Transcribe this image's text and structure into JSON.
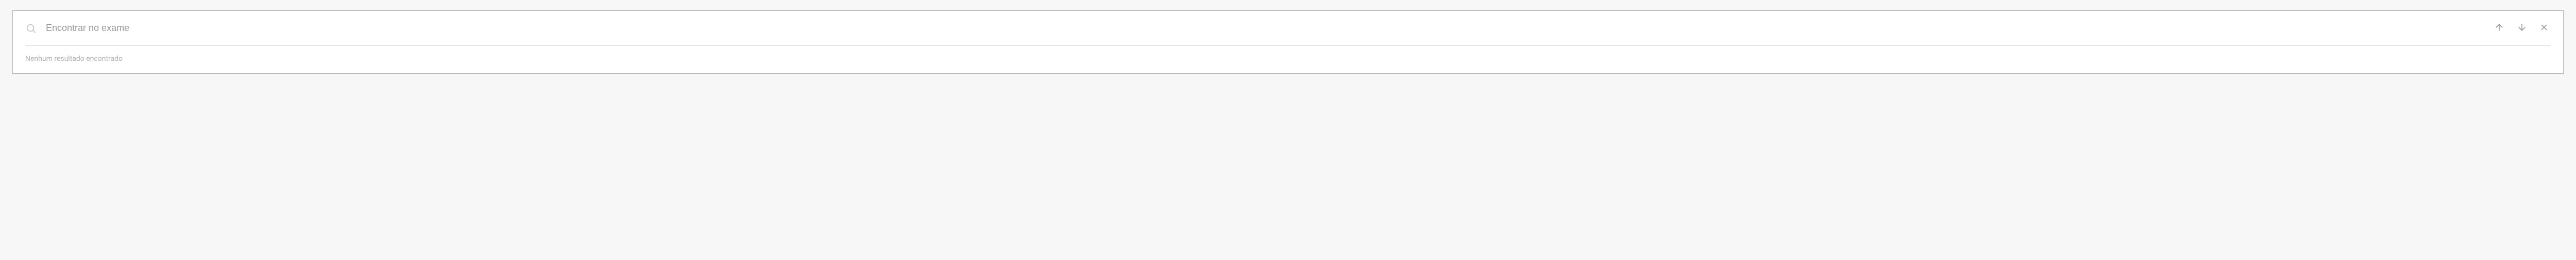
{
  "search": {
    "placeholder": "Encontrar no exame",
    "value": ""
  },
  "status": {
    "no_results": "Nenhum resultado encontrado"
  },
  "icons": {
    "search": "search-icon",
    "prev": "arrow-up-icon",
    "next": "arrow-down-icon",
    "close": "close-icon"
  }
}
